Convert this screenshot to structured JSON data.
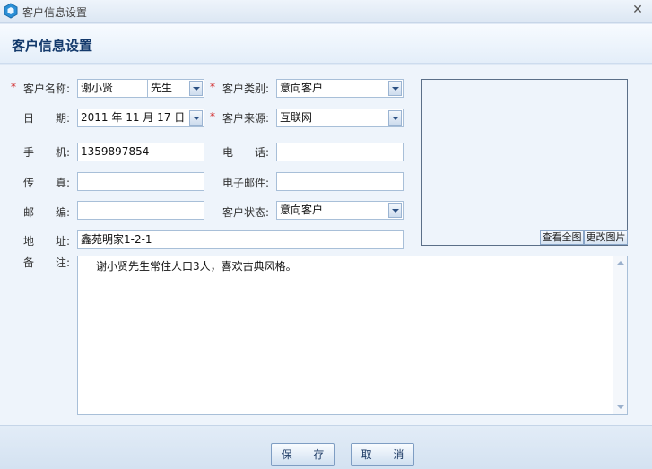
{
  "window": {
    "title": "客户信息设置"
  },
  "header": {
    "title": "客户信息设置"
  },
  "form": {
    "customer_name": {
      "label": "客户名称:",
      "value": "谢小贤",
      "title_value": "先生"
    },
    "customer_type": {
      "label": "客户类别:",
      "value": "意向客户"
    },
    "date": {
      "label1": "日",
      "label2": "期:",
      "year": "2011",
      "year_unit": "年",
      "month": "11",
      "month_unit": "月",
      "day": "17",
      "day_unit": "日"
    },
    "customer_source": {
      "label": "客户来源:",
      "value": "互联网"
    },
    "mobile": {
      "label1": "手",
      "label2": "机:",
      "value": "1359897854"
    },
    "phone": {
      "label1": "电",
      "label2": "话:",
      "value": ""
    },
    "fax": {
      "label1": "传",
      "label2": "真:",
      "value": ""
    },
    "email": {
      "label": "电子邮件:",
      "value": ""
    },
    "zip": {
      "label1": "邮",
      "label2": "编:",
      "value": ""
    },
    "status": {
      "label": "客户状态:",
      "value": "意向客户"
    },
    "address": {
      "label1": "地",
      "label2": "址:",
      "value": "鑫苑明家1-2-1"
    },
    "remark": {
      "label1": "备",
      "label2": "注:",
      "value": "谢小贤先生常住人口3人，喜欢古典风格。"
    }
  },
  "photo": {
    "view_full_label": "查看全图",
    "change_label": "更改图片"
  },
  "footer": {
    "save_label": "保 存",
    "cancel_label": "取 消"
  }
}
